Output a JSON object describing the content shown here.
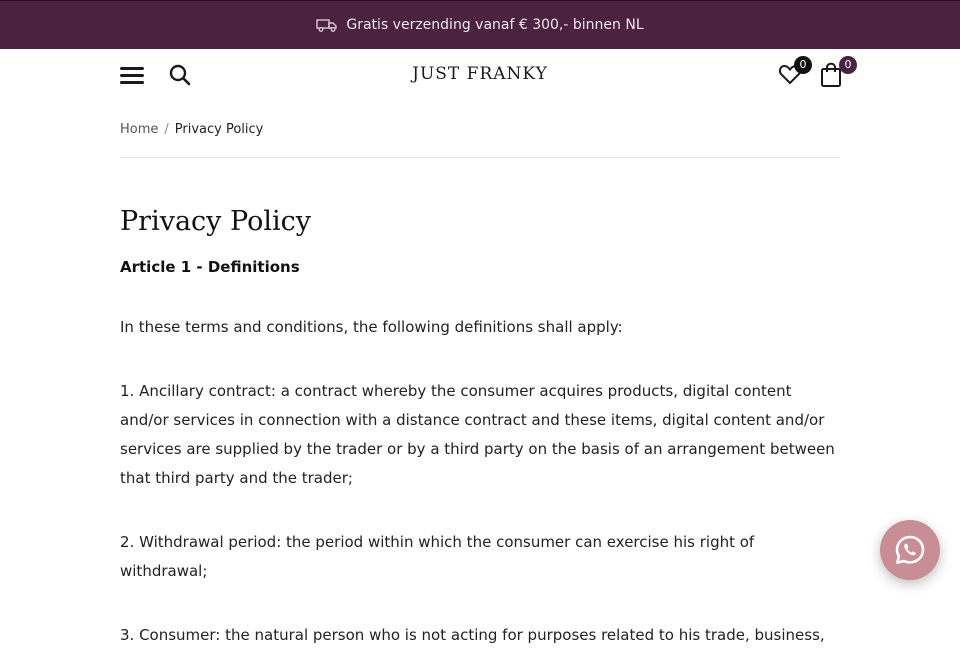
{
  "announcement": {
    "text": "Gratis verzending vanaf € 300,- binnen NL",
    "icon": "truck-icon"
  },
  "header": {
    "logo": "JUST FRANKY",
    "wishlist_count": "0",
    "cart_count": "0",
    "icons": [
      "menu-icon",
      "search-icon",
      "heart-icon",
      "shopping-bag-icon"
    ]
  },
  "breadcrumb": {
    "home": "Home",
    "separator": "/",
    "current": "Privacy Policy"
  },
  "main": {
    "title": "Privacy Policy",
    "article_heading": "Article 1 - Definitions",
    "paragraphs": [
      "In these terms and conditions, the following definitions shall apply:",
      "1. Ancillary contract: a contract whereby the consumer acquires products, digital content and/or services in connection with a distance contract and these items, digital content and/or services are supplied by the trader or by a third party on the basis of an arrangement between that third party and the trader;",
      "2. Withdrawal period: the period within which the consumer can exercise his right of withdrawal;",
      "3. Consumer: the natural person who is not acting for purposes related to his trade, business,"
    ]
  },
  "colors": {
    "brand": "#4b2240",
    "whatsapp_button": "#c98d96"
  },
  "chat_button": {
    "icon": "whatsapp-icon"
  }
}
